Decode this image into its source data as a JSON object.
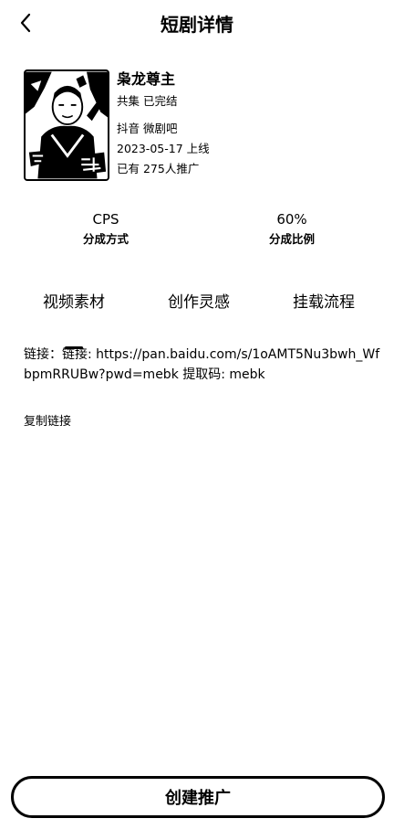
{
  "header": {
    "title": "短剧详情"
  },
  "drama": {
    "name": "枭龙尊主",
    "episodes": "共集 已完结",
    "platform": "抖音 微剧吧",
    "launch_date": "2023-05-17 上线",
    "promoters": "已有 275人推广",
    "cover_icon": "drama-poster"
  },
  "stats": {
    "mode_value": "CPS",
    "mode_label": "分成方式",
    "ratio_value": "60%",
    "ratio_label": "分成比例"
  },
  "tabs": [
    {
      "label": "视频素材",
      "active": true
    },
    {
      "label": "创作灵感",
      "active": false
    },
    {
      "label": "挂载流程",
      "active": false
    }
  ],
  "content": {
    "link_text": "链接：链接: https://pan.baidu.com/s/1oAMT5Nu3bwh_WfbpmRRUBw?pwd=mebk 提取码: mebk",
    "copy_label": "复制链接"
  },
  "footer": {
    "create_label": "创建推广"
  }
}
